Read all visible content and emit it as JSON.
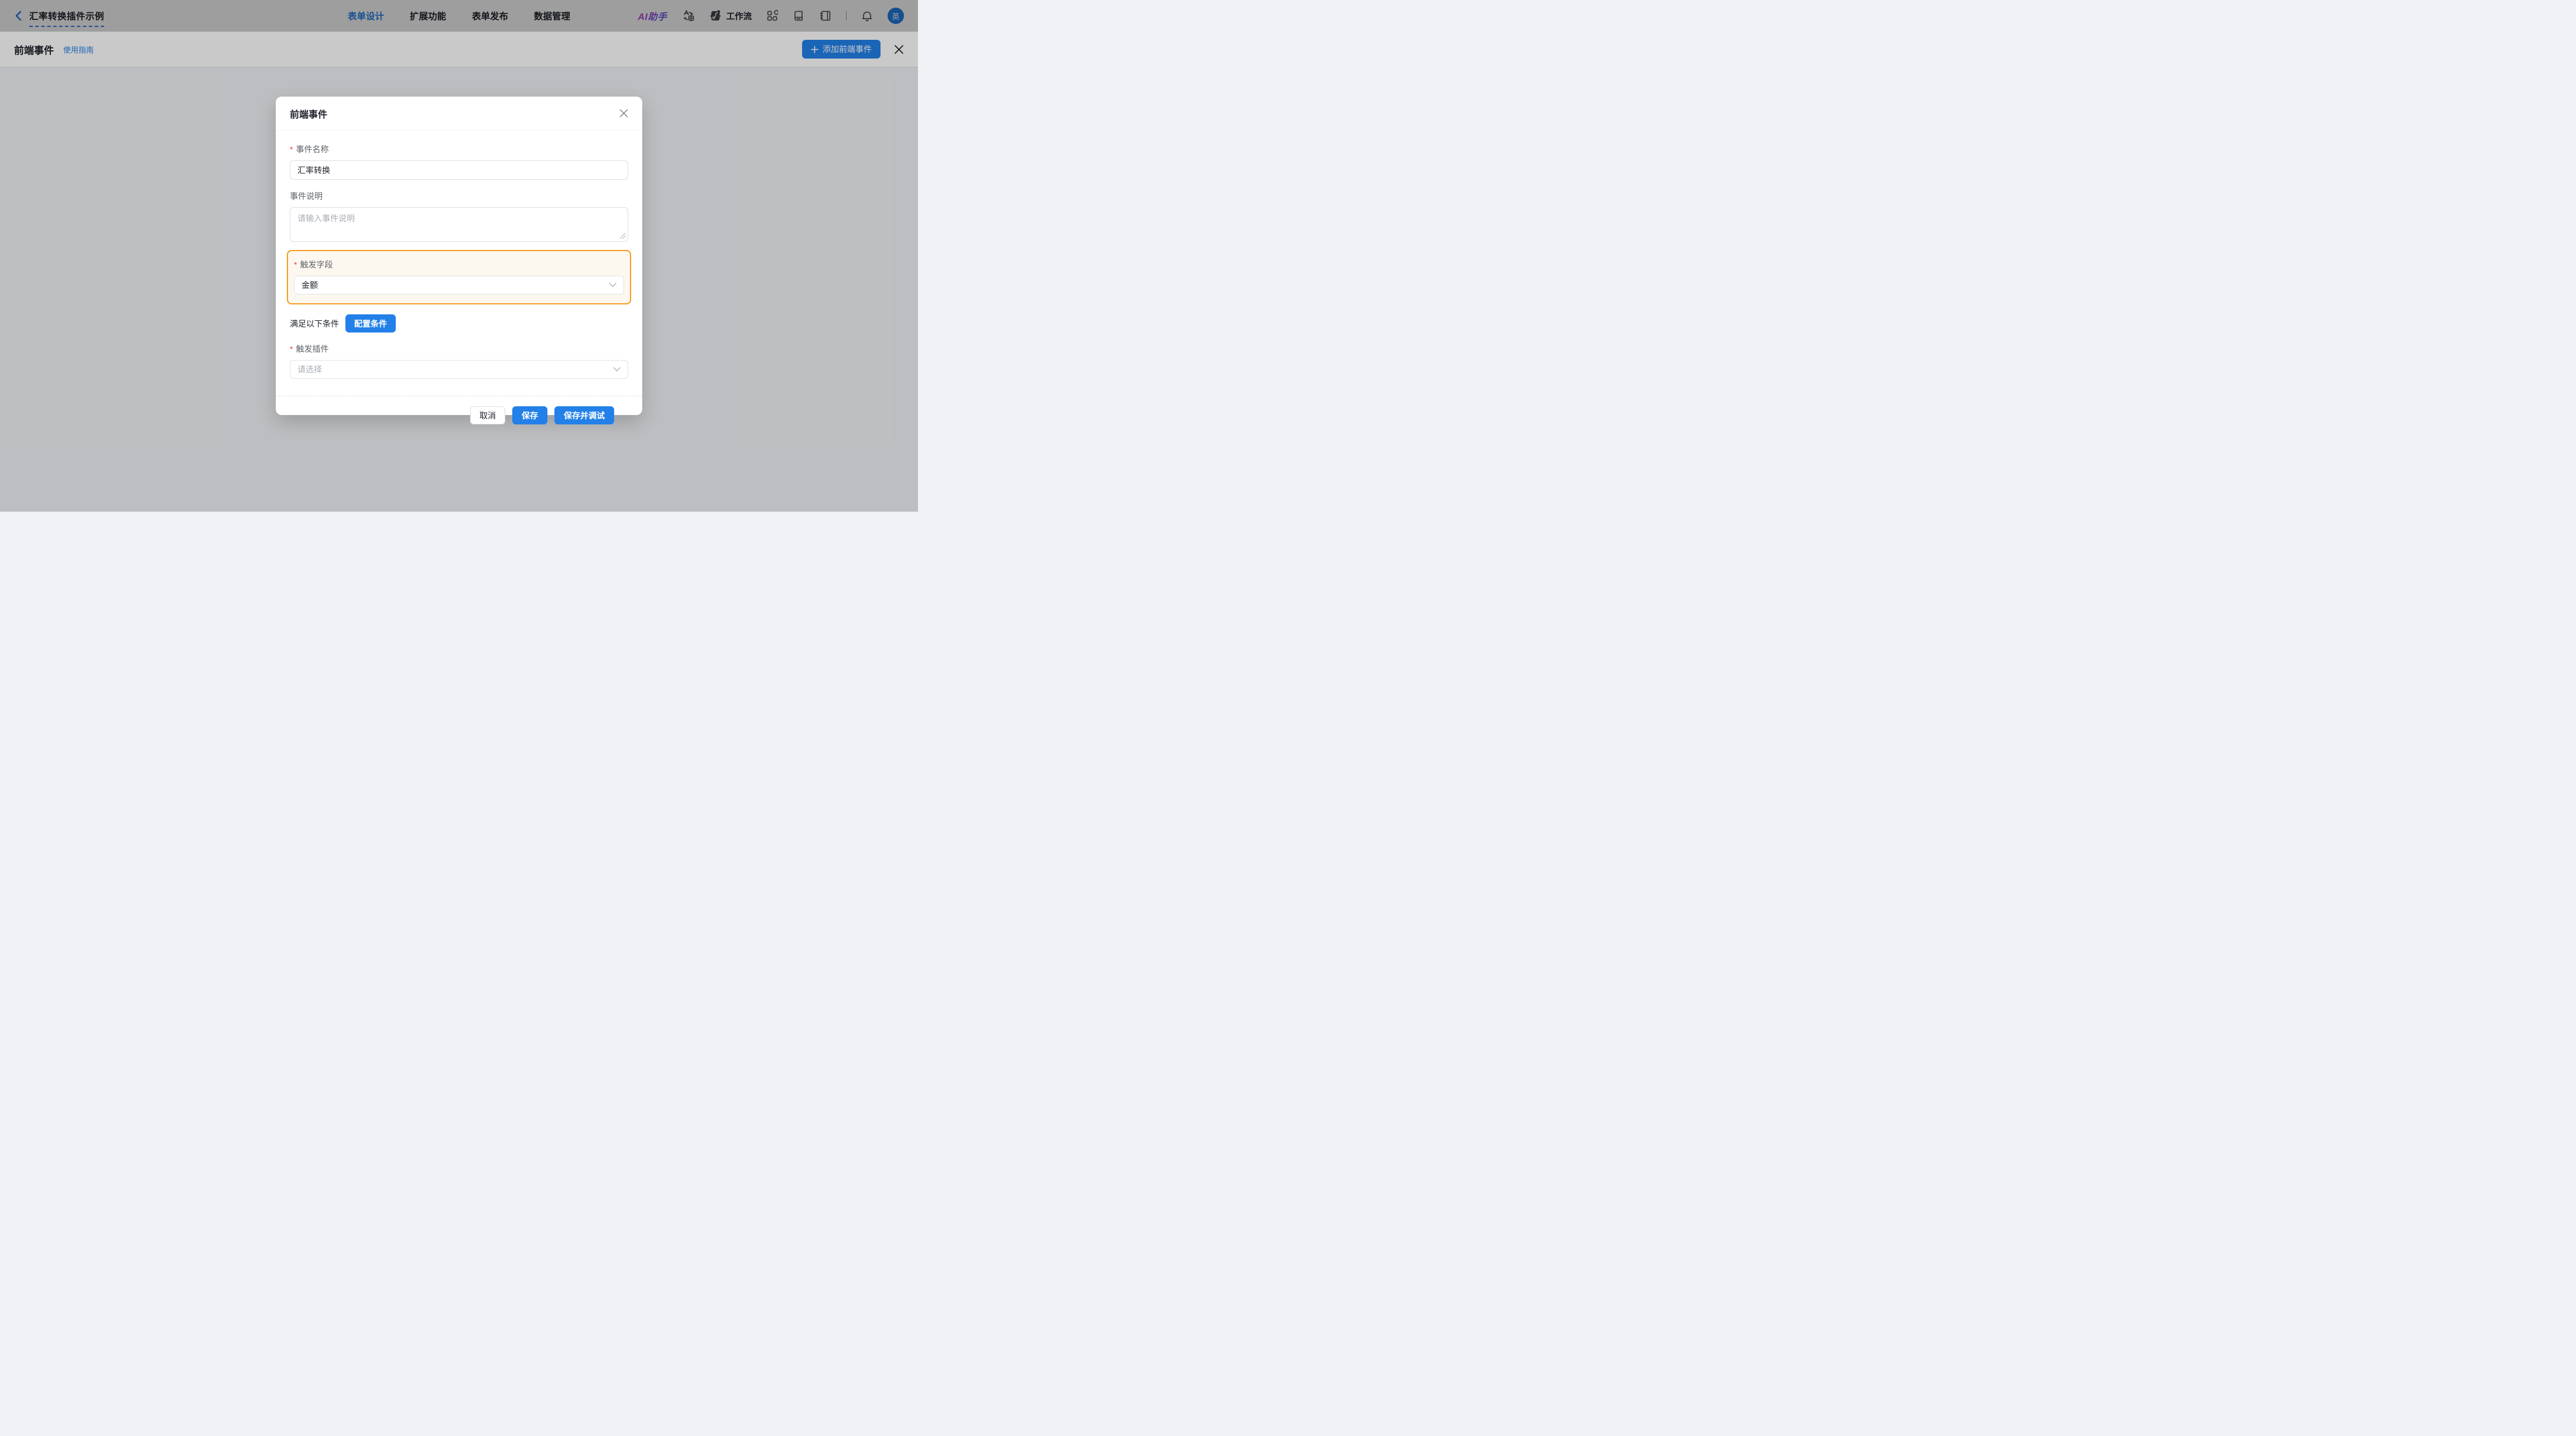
{
  "topnav": {
    "back_title": "汇率转换插件示例",
    "tabs": [
      {
        "label": "表单设计",
        "active": true
      },
      {
        "label": "扩展功能",
        "active": false
      },
      {
        "label": "表单发布",
        "active": false
      },
      {
        "label": "数据管理",
        "active": false
      }
    ],
    "ai_assistant_label": "AI助手",
    "workflow_label": "工作流",
    "avatar_text": "英"
  },
  "subheader": {
    "title": "前端事件",
    "guide_link": "使用指南",
    "add_button_label": "添加前端事件"
  },
  "modal": {
    "title": "前端事件",
    "required_mark": "*",
    "fields": {
      "event_name": {
        "label": "事件名称",
        "value": "汇率转换"
      },
      "event_desc": {
        "label": "事件说明",
        "placeholder": "请输入事件说明"
      },
      "trigger_field": {
        "label": "触发字段",
        "value": "金额"
      },
      "condition": {
        "label": "满足以下条件",
        "button_label": "配置条件"
      },
      "trigger_plugin": {
        "label": "触发插件",
        "placeholder": "请选择"
      }
    },
    "footer": {
      "cancel_label": "取消",
      "save_label": "保存",
      "save_debug_label": "保存并调试"
    }
  },
  "colors": {
    "primary_blue": "#2380e8",
    "highlight_orange_border": "#f79b1e",
    "highlight_orange_bg": "#fdf8ef",
    "required_red": "#f23f3f",
    "dashed_underline_blue": "#3f7cf0",
    "ai_gradient": [
      "#e843a0",
      "#9a4ee0",
      "#3b68e8"
    ]
  }
}
